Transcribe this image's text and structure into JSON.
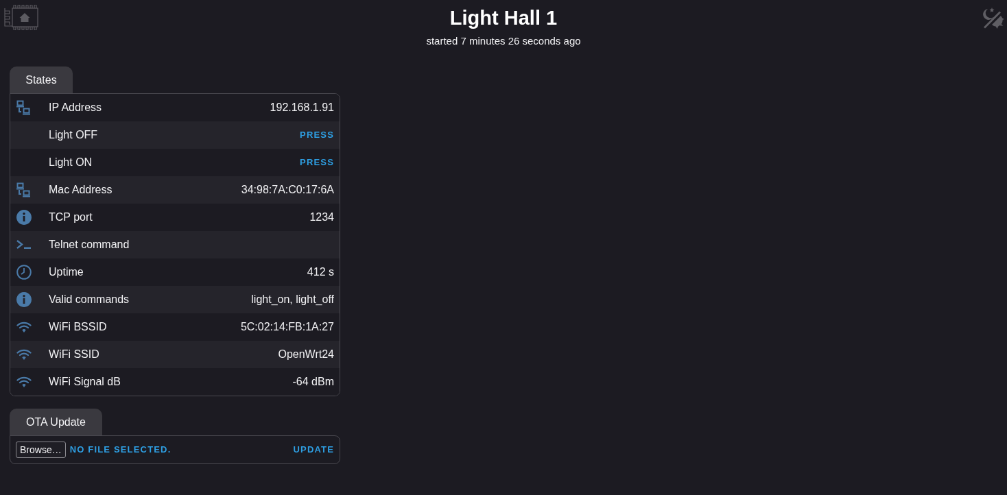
{
  "header": {
    "title": "Light Hall 1",
    "subtitle": "started 7 minutes 26 seconds ago"
  },
  "states": {
    "tab": "States",
    "rows": [
      {
        "kind": "network",
        "label": "IP Address",
        "value": "192.168.1.91"
      },
      {
        "kind": "button",
        "label": "Light OFF",
        "value": "PRESS"
      },
      {
        "kind": "button",
        "label": "Light ON",
        "value": "PRESS"
      },
      {
        "kind": "network",
        "label": "Mac Address",
        "value": "34:98:7A:C0:17:6A"
      },
      {
        "kind": "info",
        "label": "TCP port",
        "value": "1234"
      },
      {
        "kind": "terminal",
        "label": "Telnet command"
      },
      {
        "kind": "clock",
        "label": "Uptime",
        "value": "412 s"
      },
      {
        "kind": "info",
        "label": "Valid commands",
        "value": "light_on, light_off"
      },
      {
        "kind": "wifi",
        "label": "WiFi BSSID",
        "value": "5C:02:14:FB:1A:27"
      },
      {
        "kind": "wifi",
        "label": "WiFi SSID",
        "value": "OpenWrt24"
      },
      {
        "kind": "wifi",
        "label": "WiFi Signal dB",
        "value": "-64 dBm"
      }
    ]
  },
  "ota": {
    "tab": "OTA Update",
    "browse_button": "Browse…",
    "file_status": "NO FILE SELECTED.",
    "action": "UPDATE"
  }
}
